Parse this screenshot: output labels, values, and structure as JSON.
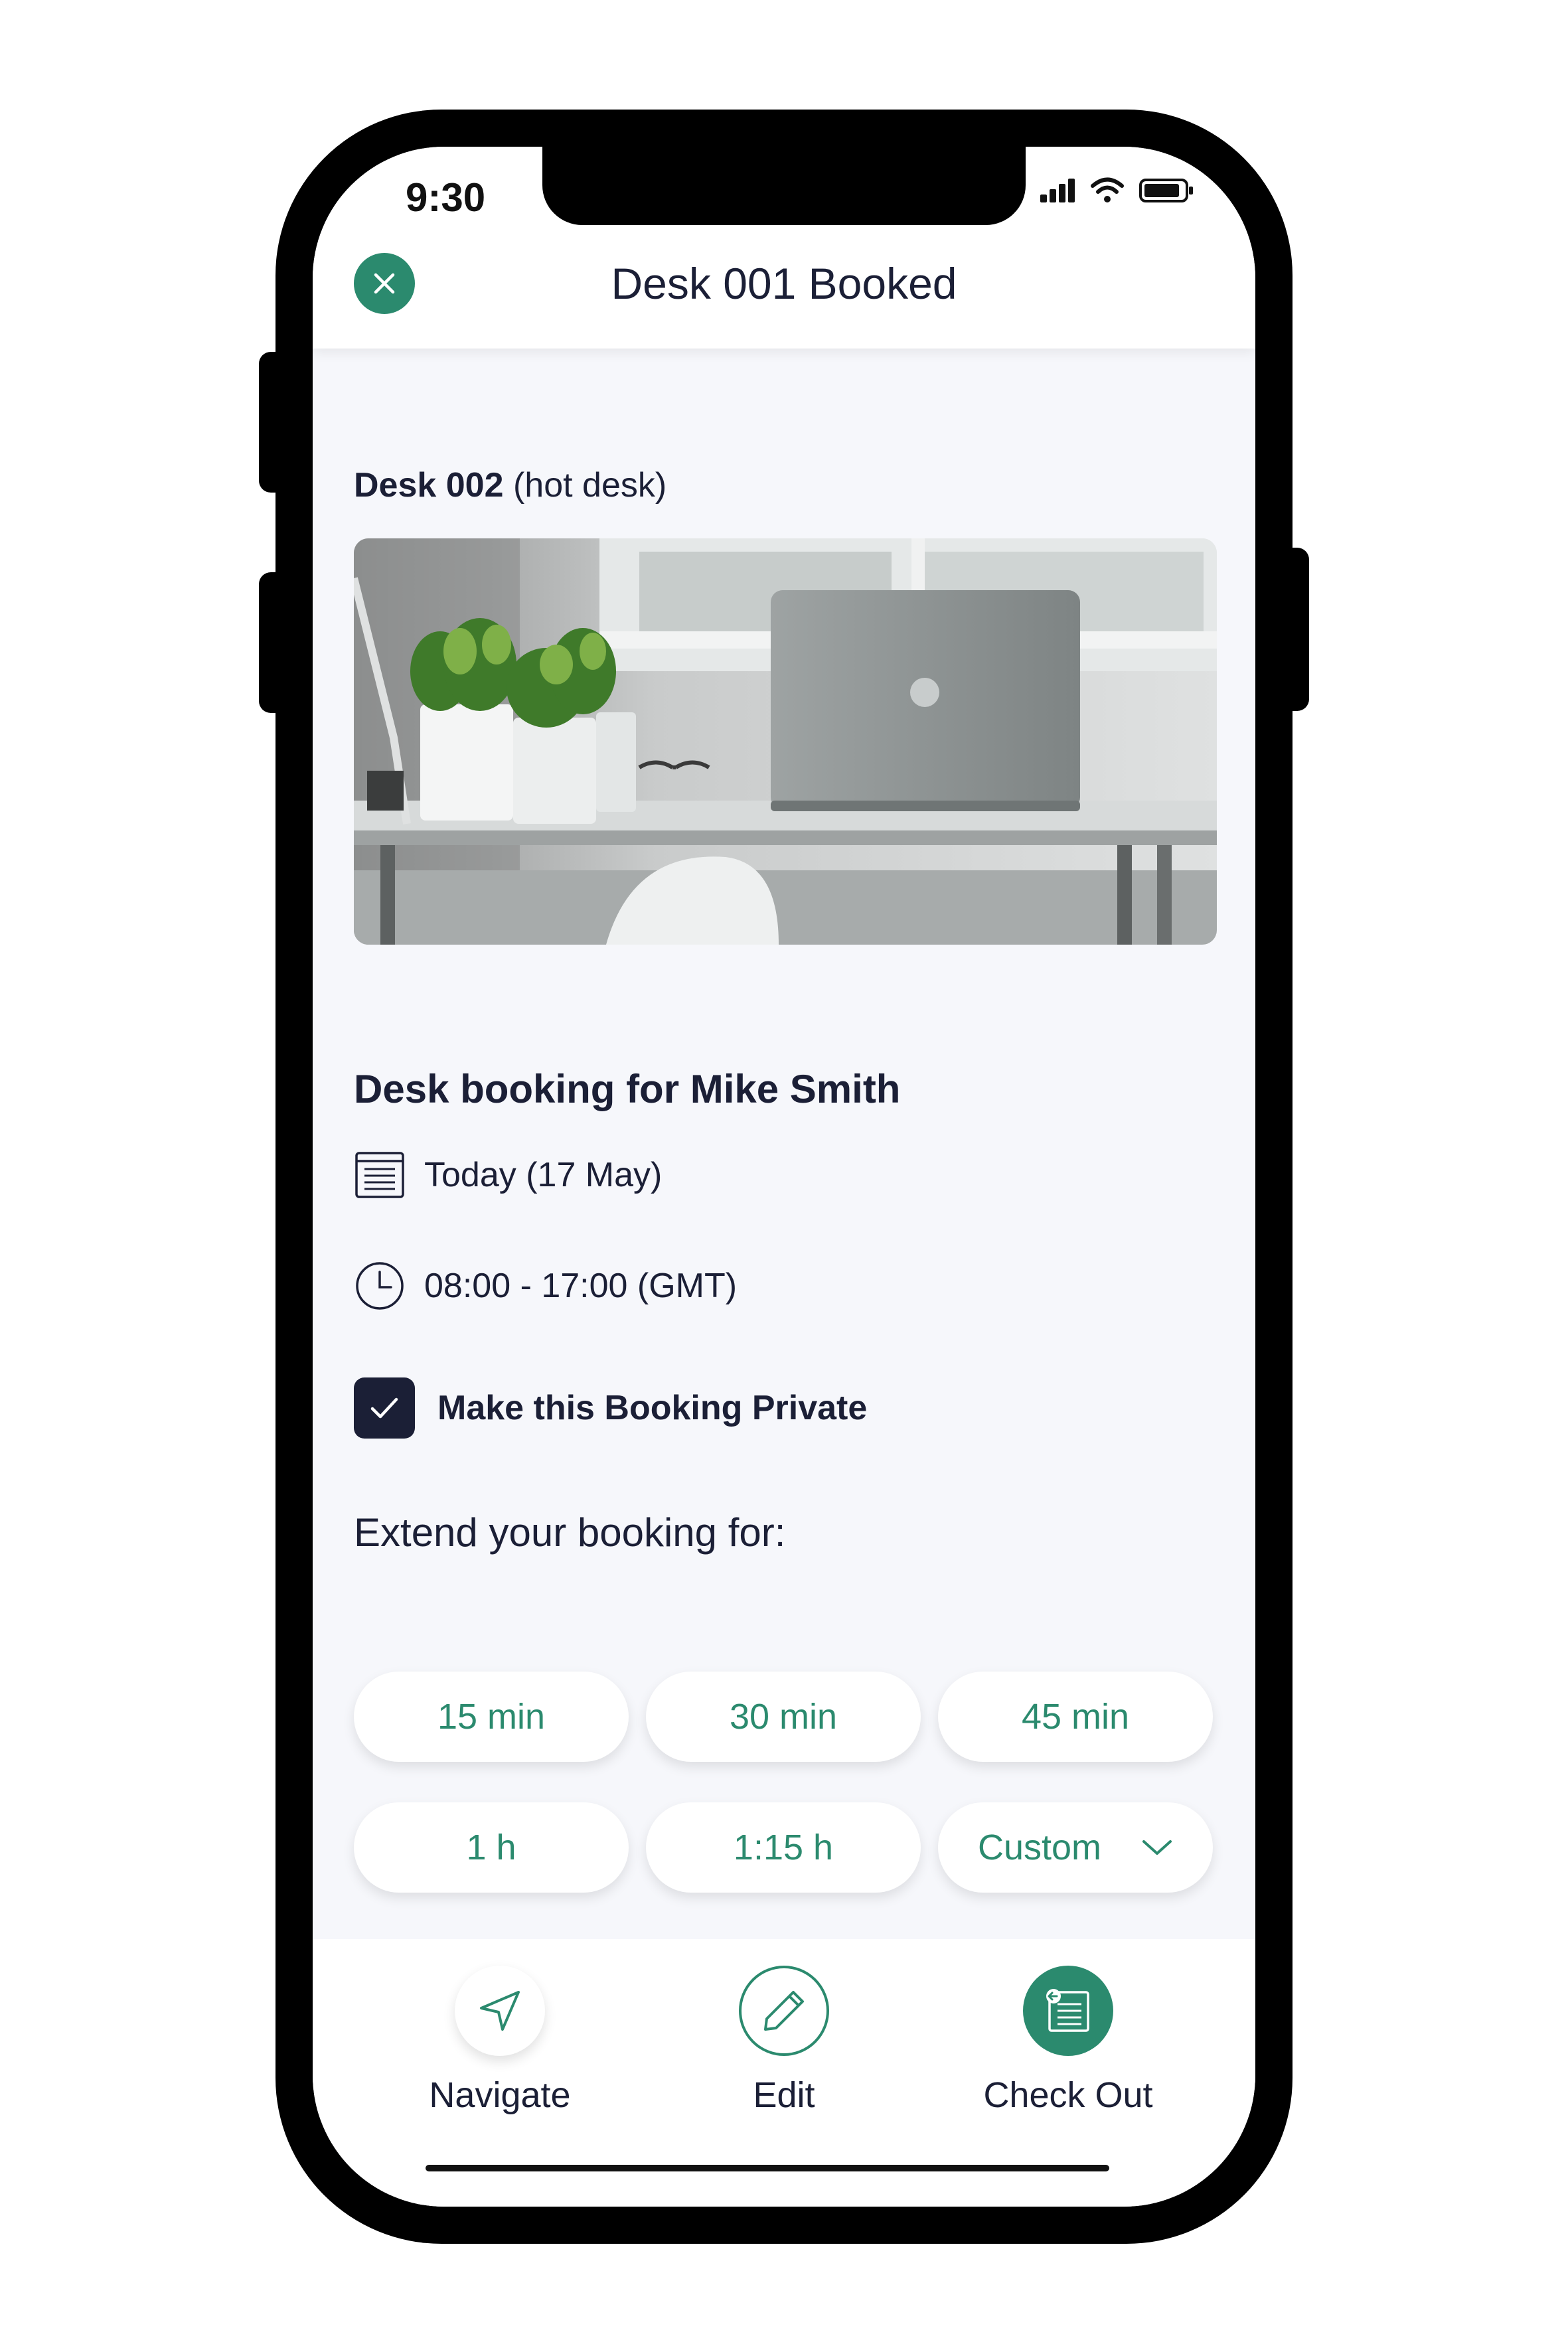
{
  "status_bar": {
    "time": "9:30"
  },
  "header": {
    "title": "Desk 001 Booked"
  },
  "desk": {
    "name": "Desk 002",
    "type": "(hot desk)"
  },
  "booking": {
    "title": "Desk booking for Mike Smith",
    "date": "Today (17 May)",
    "time": "08:00 - 17:00 (GMT)",
    "private_label": "Make this Booking Private",
    "private_checked": true
  },
  "extend": {
    "label": "Extend your booking for:",
    "options": [
      "15 min",
      "30 min",
      "45 min",
      "1 h",
      "1:15 h",
      "Custom"
    ]
  },
  "actions": {
    "navigate": "Navigate",
    "edit": "Edit",
    "check_out": "Check Out"
  },
  "colors": {
    "accent": "#2b8a6e",
    "dark": "#1b1f36",
    "background": "#f6f7fb"
  },
  "icons": [
    "close-icon",
    "calendar-icon",
    "clock-icon",
    "check-icon",
    "chevron-down-icon",
    "navigate-arrow-icon",
    "pencil-icon",
    "checkout-list-icon"
  ]
}
